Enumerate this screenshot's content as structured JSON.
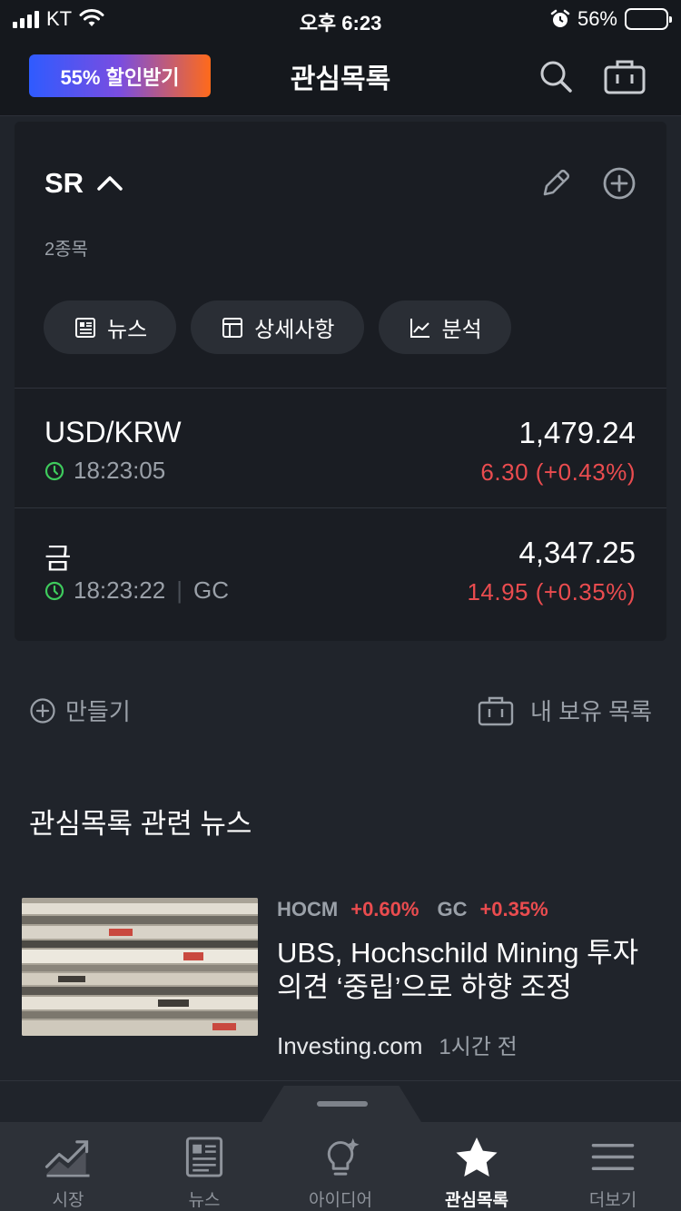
{
  "status_bar": {
    "carrier": "KT",
    "time": "오후 6:23",
    "battery": "56%"
  },
  "header": {
    "promo_label": "55% 할인받기",
    "title": "관심목록"
  },
  "watchlist": {
    "name": "SR",
    "count": "2종목",
    "buttons": [
      {
        "label": "뉴스",
        "icon": "newspaper-icon"
      },
      {
        "label": "상세사항",
        "icon": "table-icon"
      },
      {
        "label": "분석",
        "icon": "chart-icon"
      }
    ],
    "quotes": [
      {
        "name": "USD/KRW",
        "time": "18:23:05",
        "exchange": "",
        "price": "1,479.24",
        "change": "6.30",
        "change_pct": "(+0.43%)"
      },
      {
        "name": "금",
        "time": "18:23:22",
        "exchange": "GC",
        "price": "4,347.25",
        "change": "14.95",
        "change_pct": "(+0.35%)"
      }
    ]
  },
  "actions": {
    "create_label": "만들기",
    "holdings_label": "내 보유 목록"
  },
  "news": {
    "heading": "관심목록 관련 뉴스",
    "items": [
      {
        "tags": [
          {
            "symbol": "HOCM",
            "change": "+0.60%"
          },
          {
            "symbol": "GC",
            "change": "+0.35%"
          }
        ],
        "title": "UBS, Hochschild Mining 투자의견 ‘중립’으로 하향 조정",
        "source": "Investing.com",
        "time": "1시간 전"
      }
    ]
  },
  "tabs": [
    {
      "label": "시장",
      "icon": "market-chart-icon",
      "active": false
    },
    {
      "label": "뉴스",
      "icon": "newspaper-icon",
      "active": false
    },
    {
      "label": "아이디어",
      "icon": "lightbulb-icon",
      "active": false
    },
    {
      "label": "관심목록",
      "icon": "star-icon",
      "active": true
    },
    {
      "label": "더보기",
      "icon": "menu-icon",
      "active": false
    }
  ],
  "colors": {
    "negative_red": "#ea4c4f",
    "live_green": "#3ecb5c",
    "background": "#20242b"
  }
}
